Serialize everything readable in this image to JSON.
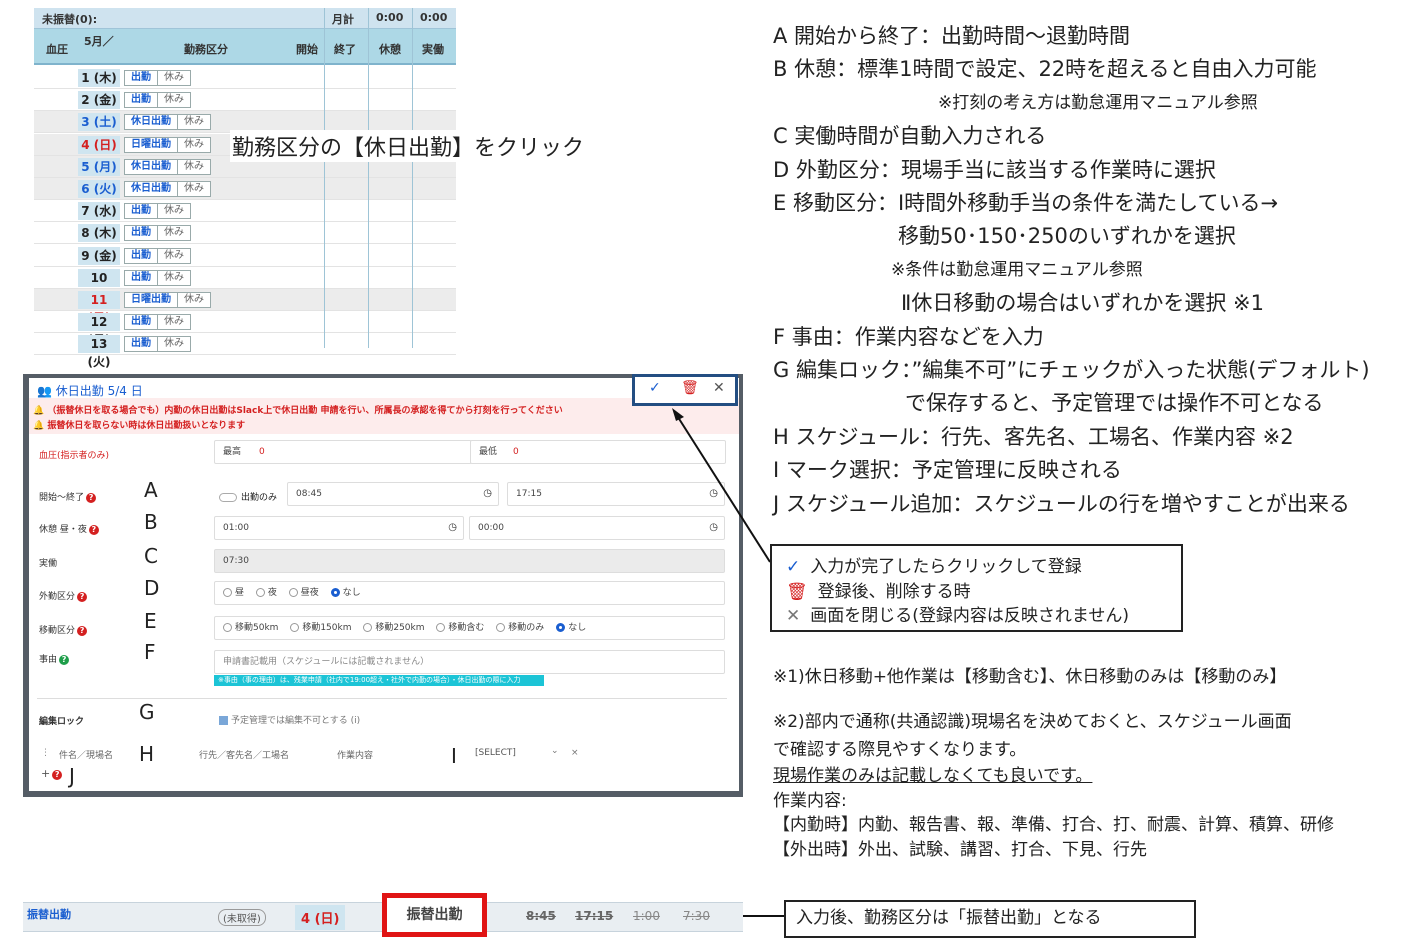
{
  "calendar": {
    "unfurikae": "未振替(0):",
    "monthly_total_label": "月計",
    "monthly_total_1": "0:00",
    "monthly_total_2": "0:00",
    "headers": [
      "血圧",
      "5月／",
      "勤務区分",
      "開始",
      "終了",
      "休憩",
      "実働"
    ],
    "rows": [
      {
        "date": "1 (木)",
        "kubun": "出勤",
        "yasumi": "休み",
        "color": "#222222",
        "shade": false
      },
      {
        "date": "2 (金)",
        "kubun": "出勤",
        "yasumi": "休み",
        "color": "#222222",
        "shade": false
      },
      {
        "date": "3 (土)",
        "kubun": "休日出勤",
        "yasumi": "休み",
        "color": "#1a5ed0",
        "shade": true
      },
      {
        "date": "4 (日)",
        "kubun": "日曜出勤",
        "yasumi": "休み",
        "color": "#d42020",
        "shade": true
      },
      {
        "date": "5 (月)",
        "kubun": "休日出勤",
        "yasumi": "休み",
        "color": "#1a5ed0",
        "shade": true
      },
      {
        "date": "6 (火)",
        "kubun": "休日出勤",
        "yasumi": "休み",
        "color": "#1a5ed0",
        "shade": true
      },
      {
        "date": "7 (水)",
        "kubun": "出勤",
        "yasumi": "休み",
        "color": "#222222",
        "shade": false
      },
      {
        "date": "8 (木)",
        "kubun": "出勤",
        "yasumi": "休み",
        "color": "#222222",
        "shade": false
      },
      {
        "date": "9 (金)",
        "kubun": "出勤",
        "yasumi": "休み",
        "color": "#222222",
        "shade": false
      },
      {
        "date": "10 (土)",
        "kubun": "出勤",
        "yasumi": "休み",
        "color": "#222222",
        "shade": false
      },
      {
        "date": "11 (日)",
        "kubun": "日曜出勤",
        "yasumi": "休み",
        "color": "#d42020",
        "shade": true
      },
      {
        "date": "12 (月)",
        "kubun": "出勤",
        "yasumi": "休み",
        "color": "#222222",
        "shade": false
      },
      {
        "date": "13 (火)",
        "kubun": "出勤",
        "yasumi": "休み",
        "color": "#222222",
        "shade": false
      }
    ]
  },
  "click_note": "勤務区分の【休日出勤】をクリック",
  "dialog": {
    "title": "休日出勤 5/4 日",
    "warning_1": "（振替休日を取る場合でも）内勤の休日出勤はSlack上で休日出勤 申請を行い、所属長の承認を得てから打刻を行ってください",
    "warning_2": "振替休日を取らない時は休日出勤扱いとなります",
    "bp_label": "血圧(指示者のみ)",
    "bp_max_label": "最高",
    "bp_max_value": "0",
    "bp_min_label": "最低",
    "bp_min_value": "0",
    "start_end_label": "開始～終了",
    "only_shukkin": "出勤のみ",
    "start": "08:45",
    "end": "17:15",
    "break_label": "休憩 昼・夜",
    "break_day": "01:00",
    "break_night": "00:00",
    "actual_label": "実働",
    "actual_value": "07:30",
    "gaikin_label": "外勤区分",
    "gaikin_options": [
      "昼",
      "夜",
      "昼夜",
      "なし"
    ],
    "idou_label": "移動区分",
    "idou_options": [
      "移動50km",
      "移動150km",
      "移動250km",
      "移動含む",
      "移動のみ",
      "なし"
    ],
    "reason_label": "事由",
    "reason_placeholder": "申請書記載用（スケジュールには記載されません）",
    "reason_note": "※事由（事の理由）は、残業申請（社内で19:00超え・社外で内勤の場合）・休日出勤の際に入力",
    "lock_label": "編集ロック",
    "lock_text": "予定管理では編集不可とする",
    "sched_col_1": "件名／現場名",
    "sched_col_2": "行先／客先名／工場名",
    "sched_col_3": "作業内容",
    "sched_select": "[SELECT]",
    "plus": "+",
    "letters": [
      "A",
      "B",
      "C",
      "D",
      "E",
      "F",
      "G",
      "H",
      "I",
      "J"
    ]
  },
  "right_text": {
    "lines": [
      "A 開始から終了：出勤時間～退勤時間",
      "B 休憩：標準1時間で設定、22時を超えると自由入力可能",
      "※打刻の考え方は勤怠運用マニュアル参照",
      "C 実働時間が自動入力される",
      "D 外勤区分：現場手当に該当する作業時に選択",
      "E 移動区分：Ⅰ時間外移動手当の条件を満たしている→",
      "移動50･150･250のいずれかを選択",
      "※条件は勤怠運用マニュアル参照",
      "Ⅱ休日移動の場合はいずれかを選択 ※1",
      "F 事由：作業内容などを入力",
      "G 編集ロック：”編集不可”にチェックが入った状態(デフォルト)",
      "で保存すると、予定管理では操作不可となる",
      "H スケジュール：行先、客先名、工場名、作業内容 ※2",
      "I マーク選択：予定管理に反映される",
      "J スケジュール追加：スケジュールの行を増やすことが出来る"
    ]
  },
  "legend": {
    "check": "入力が完了したらクリックして登録",
    "trash": "登録後、削除する時",
    "close": "画面を閉じる(登録内容は反映されません)"
  },
  "notes": {
    "note1": "※1)休日移動+他作業は【移動含む】、休日移動のみは【移動のみ】",
    "note2a": "※2)部内で通称(共通認識)現場名を決めておくと、スケジュール画面",
    "note2b": "で確認する際見やすくなります。",
    "note2c": "現場作業のみは記載しなくても良いです。",
    "work_label": "作業内容:",
    "work_in": "【内勤時】内勤、報告書、報、準備、打合、打、耐震、計算、積算、研修",
    "work_out": "【外出時】外出、試験、講習、打合、下見、行先"
  },
  "bottom": {
    "label": "振替出勤",
    "unobtained": "(未取得)",
    "date": "4 (日)",
    "kubun": "振替出勤",
    "start": "8:45",
    "end": "17:15",
    "break": "1:00",
    "actual": "7:30",
    "result": "入力後、勤務区分は「振替出勤」となる"
  }
}
